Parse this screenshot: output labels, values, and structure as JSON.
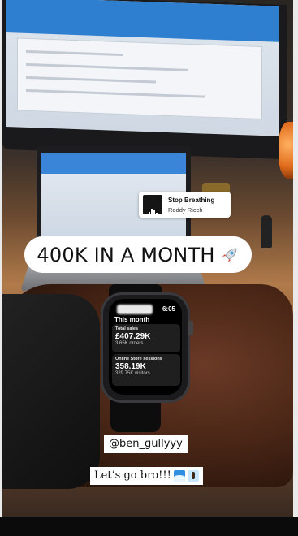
{
  "music_sticker": {
    "title": "Stop Breathing",
    "artist": "Roddy Ricch",
    "icon": "audio-bars-icon"
  },
  "headline": {
    "text": "400K IN A MONTH",
    "emoji": "rocket-icon"
  },
  "watch": {
    "time": "6:05",
    "heading": "This month",
    "cards": [
      {
        "label": "Total sales",
        "value": "£407.29K",
        "sub": "3.65K orders"
      },
      {
        "label": "Online Store sessions",
        "value": "358.19K",
        "sub": "329.75K visitors"
      }
    ],
    "page_dots": 3,
    "active_dot": 2
  },
  "mention": "@ben_gullyyy",
  "caption": {
    "text": "Let’s go bro!!!",
    "emojis": [
      "wave-icon",
      "surfer-icon"
    ]
  }
}
